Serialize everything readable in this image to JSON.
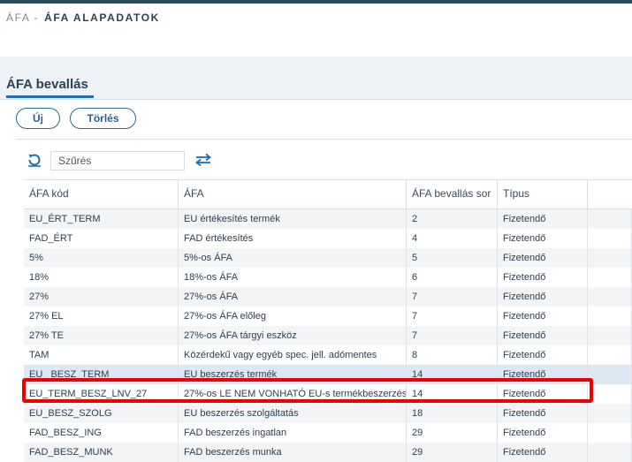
{
  "breadcrumb": {
    "parent": "ÁFA",
    "separator": "-",
    "current": "ÁFA ALAPADATOK"
  },
  "section": {
    "title": "ÁFA bevallás"
  },
  "toolbar": {
    "new_label": "Új",
    "delete_label": "Törlés"
  },
  "filter": {
    "placeholder": "Szűrés",
    "value": ""
  },
  "icons": {
    "refresh": "refresh-icon",
    "swap": "swap-arrows-icon"
  },
  "colors": {
    "accent": "#1f6fae",
    "highlight_border": "#ee0000",
    "selected_row": "#dde8f3"
  },
  "table": {
    "columns": [
      "ÁFA kód",
      "ÁFA",
      "ÁFA bevallás sor",
      "Típus",
      ""
    ],
    "rows": [
      {
        "code": "EU_ÉRT_TERM",
        "name": "EU értékesítés termék",
        "line": "2",
        "type": "Fizetendő"
      },
      {
        "code": "FAD_ÉRT",
        "name": "FAD értékesítés",
        "line": "4",
        "type": "Fizetendő"
      },
      {
        "code": "5%",
        "name": "5%-os ÁFA",
        "line": "5",
        "type": "Fizetendő"
      },
      {
        "code": "18%",
        "name": "18%-os ÁFA",
        "line": "6",
        "type": "Fizetendő"
      },
      {
        "code": "27%",
        "name": "27%-os ÁFA",
        "line": "7",
        "type": "Fizetendő"
      },
      {
        "code": "27% EL",
        "name": "27%-os ÁFA előleg",
        "line": "7",
        "type": "Fizetendő"
      },
      {
        "code": "27% TE",
        "name": "27%-os ÁFA tárgyi eszköz",
        "line": "7",
        "type": "Fizetendő"
      },
      {
        "code": "TAM",
        "name": "Közérdekű vagy egyéb spec. jell. adómentes",
        "line": "8",
        "type": "Fizetendő"
      },
      {
        "code": "EU _BESZ_TERM",
        "name": "EU beszerzés termék",
        "line": "14",
        "type": "Fizetendő"
      },
      {
        "code": "EU_TERM_BESZ_LNV_27",
        "name": "27%-os LE NEM VONHATÓ EU-s termékbeszerzés",
        "line": "14",
        "type": "Fizetendő"
      },
      {
        "code": "EU_BESZ_SZOLG",
        "name": "EU beszerzés szolgáltatás",
        "line": "18",
        "type": "Fizetendő"
      },
      {
        "code": "FAD_BESZ_ING",
        "name": "FAD beszerzés ingatlan",
        "line": "29",
        "type": "Fizetendő"
      },
      {
        "code": "FAD_BESZ_MUNK",
        "name": "FAD beszerzés munka",
        "line": "29",
        "type": "Fizetendő"
      }
    ]
  }
}
